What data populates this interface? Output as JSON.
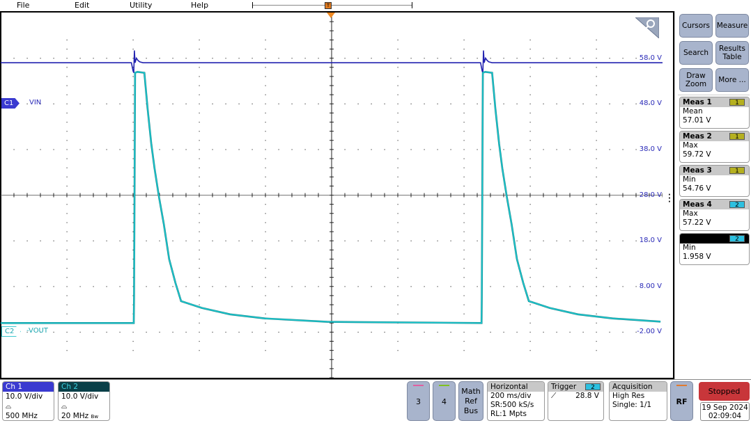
{
  "menu": {
    "items": [
      "File",
      "Edit",
      "Utility",
      "Help"
    ]
  },
  "trigger_marker": "T",
  "channels": {
    "c1": {
      "marker": "C1",
      "label": "VIN",
      "color": "#2a2ab8"
    },
    "c2": {
      "marker": "C2",
      "label": "-VOUT",
      "color": "#1ecfd6"
    }
  },
  "scale_labels": [
    "58.0 V",
    "48.0 V",
    "38.0 V",
    "28.0 V",
    "18.0 V",
    "8.00 V",
    "-2.00 V"
  ],
  "right_panel": {
    "buttons": [
      "Cursors",
      "Measure",
      "Search",
      "Results Table",
      "Draw Zoom",
      "More ..."
    ],
    "measurements": [
      {
        "title": "Meas 1",
        "source": "1",
        "type": "Mean",
        "value": "57.01 V"
      },
      {
        "title": "Meas 2",
        "source": "1",
        "type": "Max",
        "value": "59.72 V"
      },
      {
        "title": "Meas 3",
        "source": "1",
        "type": "Min",
        "value": "54.76 V"
      },
      {
        "title": "Meas 4",
        "source": "2",
        "type": "Max",
        "value": "57.22 V"
      },
      {
        "title": "",
        "source": "2",
        "type": "Min",
        "value": "1.958 V"
      }
    ]
  },
  "bottom": {
    "ch1": {
      "title": "Ch 1",
      "scale": "10.0 V/div",
      "bandwidth": "500 MHz"
    },
    "ch2": {
      "title": "Ch 2",
      "scale": "10.0 V/div",
      "bandwidth": "20 MHz",
      "bw_flag": "Bw"
    },
    "ch3": "3",
    "ch4": "4",
    "math_ref_bus": [
      "Math",
      "Ref",
      "Bus"
    ],
    "horizontal": {
      "title": "Horizontal",
      "scale": "200 ms/div",
      "sample_rate": "SR:500 kS/s",
      "record_length": "RL:1 Mpts"
    },
    "trigger": {
      "title": "Trigger",
      "source": "2",
      "level": "28.8 V"
    },
    "acquisition": {
      "title": "Acquisition",
      "mode": "High Res",
      "count": "Single: 1/1"
    },
    "rf": "RF",
    "status": "Stopped",
    "date": "19 Sep 2024",
    "time": "02:09:04"
  },
  "chart_data": {
    "type": "line",
    "xlim": [
      -1.0,
      1.0
    ],
    "ylim": [
      -12,
      68
    ],
    "x_unit": "s",
    "grid": true,
    "series": [
      {
        "name": "VIN",
        "color": "#2222b0",
        "x": [
          -1.0,
          -0.605,
          -0.6,
          -0.598,
          -0.596,
          -0.594,
          -0.59,
          -0.585,
          -0.58,
          -0.57,
          0.45,
          0.455,
          0.457,
          0.459,
          0.461,
          0.465,
          0.47,
          0.475,
          0.485,
          1.0
        ],
        "y": [
          57.0,
          57.0,
          55.2,
          54.8,
          59.7,
          57.0,
          58.0,
          57.5,
          57.2,
          57.0,
          57.0,
          55.2,
          54.8,
          59.7,
          57.0,
          58.0,
          57.5,
          57.2,
          57.0,
          57.0
        ]
      },
      {
        "name": "-VOUT",
        "color": "#1ecfd6",
        "x": [
          -1.0,
          -0.598,
          -0.597,
          -0.596,
          -0.595,
          -0.594,
          -0.587,
          -0.566,
          -0.556,
          -0.545,
          -0.535,
          -0.522,
          -0.507,
          -0.491,
          -0.472,
          -0.455,
          -0.392,
          -0.307,
          -0.202,
          -0.013,
          0.453,
          0.454,
          0.455,
          0.456,
          0.457,
          0.464,
          0.485,
          0.495,
          0.506,
          0.516,
          0.529,
          0.544,
          0.56,
          0.579,
          0.596,
          0.659,
          0.744,
          0.849,
          0.994
        ],
        "y": [
          0.0,
          0.0,
          5.7,
          21.6,
          38.8,
          54.8,
          55.0,
          54.8,
          46.9,
          39.3,
          33.8,
          27.8,
          21.6,
          14.0,
          8.8,
          4.8,
          3.3,
          1.9,
          1.0,
          0.25,
          0.0,
          5.7,
          21.6,
          38.8,
          54.8,
          55.0,
          54.8,
          46.9,
          39.3,
          33.8,
          27.8,
          21.6,
          14.0,
          8.8,
          4.8,
          3.3,
          1.9,
          1.0,
          0.3
        ]
      }
    ]
  }
}
